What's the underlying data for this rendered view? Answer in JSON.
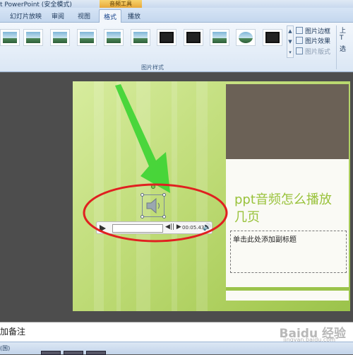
{
  "window": {
    "title": "t PowerPoint (安全模式)",
    "context_tab_group": "音频工具"
  },
  "tabs": [
    {
      "label": "幻灯片放映"
    },
    {
      "label": "审阅"
    },
    {
      "label": "视图"
    },
    {
      "label": "格式",
      "active": true
    },
    {
      "label": "播放"
    }
  ],
  "ribbon": {
    "picture_styles_group_label": "图片样式",
    "commands": {
      "picture_border": "图片边框",
      "picture_effects": "图片效果",
      "picture_layout": "图片版式"
    },
    "right_group": [
      "上",
      "T",
      "选"
    ],
    "gallery_scroll": [
      "▲",
      "▼",
      "▾"
    ]
  },
  "slide": {
    "title": "ppt音频怎么播放几页",
    "subtitle_placeholder": "单击此处添加副标题",
    "colors": {
      "background": "#bedb76",
      "title": "#99c23b",
      "photo": "#6b6156"
    }
  },
  "media_player": {
    "time": "00:05.43",
    "seek_label": "◀|| ▶",
    "volume_icon": "🔊"
  },
  "notes": {
    "text": "加备注"
  },
  "status": {
    "text": "(国)"
  },
  "watermark": {
    "text": "Baidu 经验",
    "sub": "jingyan.baidu.com"
  },
  "annotations": {
    "arrow_color": "#3bd432",
    "ellipse_color": "#e02020"
  }
}
